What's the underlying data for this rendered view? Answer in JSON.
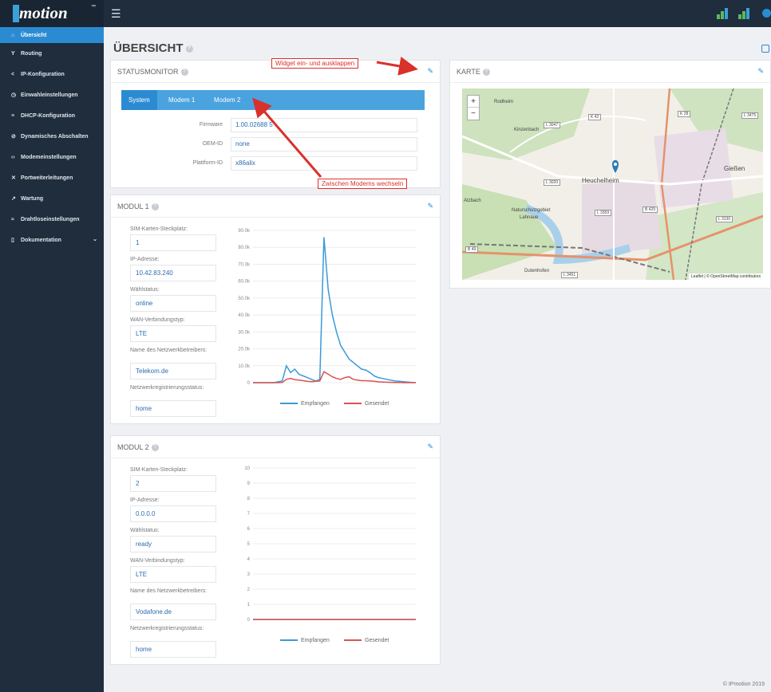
{
  "app": {
    "logo": "motion",
    "logo_tm": "™",
    "menu_icon": "hamburger-icon"
  },
  "sidebar": {
    "items": [
      {
        "label": "Übersicht",
        "icon": "home-icon",
        "active": true
      },
      {
        "label": "Routing",
        "icon": "routing-icon"
      },
      {
        "label": "IP-Konfiguration",
        "icon": "share-icon"
      },
      {
        "label": "Einwahleinstellungen",
        "icon": "dial-icon"
      },
      {
        "label": "DHCP-Konfiguration",
        "icon": "dhcp-icon"
      },
      {
        "label": "Dynamisches Abschalten",
        "icon": "power-icon"
      },
      {
        "label": "Modemeinstellungen",
        "icon": "code-icon"
      },
      {
        "label": "Portweiterleitungen",
        "icon": "shuffle-icon"
      },
      {
        "label": "Wartung",
        "icon": "wrench-icon"
      },
      {
        "label": "Drahtloseinstellungen",
        "icon": "wifi-icon"
      },
      {
        "label": "Dokumentation",
        "icon": "book-icon",
        "chevron": "chevron-down-icon"
      }
    ]
  },
  "page": {
    "title": "ÜBERSICHT",
    "help": "?",
    "footer": "© IPmotion 2019"
  },
  "status_monitor": {
    "title": "STATUSMONITOR",
    "tabs": [
      "System",
      "Modem 1",
      "Modem 2"
    ],
    "fields": [
      {
        "label": "Firmware",
        "value": "1.00.02688 5"
      },
      {
        "label": "OEM-ID",
        "value": "none"
      },
      {
        "label": "Plattform-ID",
        "value": "x86alix"
      }
    ]
  },
  "annotations": {
    "widget": "Widget ein- und ausklappen",
    "modems": "Zwischen Modems wechseln"
  },
  "modul1": {
    "title": "MODUL 1",
    "fields": [
      {
        "label": "SIM-Karten-Steckplatz:",
        "value": "1"
      },
      {
        "label": "IP-Adresse:",
        "value": "10.42.83.240"
      },
      {
        "label": "Wählstatus:",
        "value": "online"
      },
      {
        "label": "WAN-Verbindungstyp:",
        "value": "LTE"
      },
      {
        "label": "Name des Netzwerkbetreibers:",
        "value": "Telekom.de"
      },
      {
        "label": "Netzwerkregistrierungsstatus:",
        "value": "home"
      }
    ],
    "y_ticks": [
      "90.0k",
      "80.0k",
      "70.0k",
      "60.0k",
      "50.0k",
      "40.0k",
      "30.0k",
      "20.0k",
      "10.0k",
      "0"
    ],
    "legend": [
      "Empfangen",
      "Gesendet"
    ]
  },
  "modul2": {
    "title": "MODUL 2",
    "fields": [
      {
        "label": "SIM-Karten-Steckplatz:",
        "value": "2"
      },
      {
        "label": "IP-Adresse:",
        "value": "0.0.0.0"
      },
      {
        "label": "Wählstatus:",
        "value": "ready"
      },
      {
        "label": "WAN-Verbindungstyp:",
        "value": "LTE"
      },
      {
        "label": "Name des Netzwerkbetreibers:",
        "value": "Vodafone.de"
      },
      {
        "label": "Netzwerkregistrierungsstatus:",
        "value": "home"
      }
    ],
    "y_ticks": [
      "10",
      "9",
      "8",
      "7",
      "6",
      "5",
      "4",
      "3",
      "2",
      "1",
      "0"
    ],
    "legend": [
      "Empfangen",
      "Gesendet"
    ]
  },
  "karte": {
    "title": "KARTE",
    "zoom_in": "+",
    "zoom_out": "−",
    "labels": [
      "Heuchelheim",
      "Gießen",
      "Naturschutzgebiet",
      "Lahnaue",
      "Dutenhofen",
      "Kinzenbach",
      "Atzbach",
      "Rodheim"
    ],
    "roads": [
      "L 3047",
      "K 42",
      "K 28",
      "L 3475",
      "L 3020",
      "L 3359",
      "B 429",
      "L 3130",
      "B 49",
      "L 3451"
    ],
    "attribution": "Leaflet | © OpenStreetMap contributors"
  },
  "colors": {
    "accent": "#2b8bd2",
    "received": "#3a9ad9",
    "sent": "#d9534f",
    "annotation": "#d9312b"
  },
  "chart_data": [
    {
      "type": "line",
      "title": "MODUL 1",
      "ylim": [
        0,
        90000
      ],
      "x": [
        0,
        1,
        2,
        3,
        4,
        5,
        6,
        7,
        8,
        9,
        10,
        11,
        12,
        13,
        14,
        15,
        16,
        17,
        18,
        19,
        20,
        21,
        22,
        23,
        24,
        25,
        26,
        27,
        28,
        29,
        30,
        31,
        32,
        33,
        34,
        35,
        36,
        37,
        38,
        39
      ],
      "series": [
        {
          "name": "Empfangen",
          "values": [
            0,
            0,
            0,
            0,
            0,
            0,
            500,
            1000,
            10000,
            6000,
            8000,
            5000,
            4000,
            3000,
            2000,
            1000,
            2000,
            86000,
            55000,
            40000,
            30000,
            22000,
            18000,
            14000,
            12000,
            10000,
            8000,
            7500,
            6000,
            4000,
            3000,
            2500,
            2000,
            1500,
            1000,
            800,
            600,
            400,
            200,
            100
          ]
        },
        {
          "name": "Gesendet",
          "values": [
            0,
            0,
            0,
            0,
            0,
            0,
            0,
            100,
            2000,
            2500,
            1800,
            1500,
            1200,
            800,
            600,
            800,
            1000,
            6500,
            5000,
            3500,
            2500,
            2000,
            3000,
            3500,
            2000,
            1500,
            1200,
            1200,
            1000,
            800,
            500,
            400,
            300,
            200,
            100,
            100,
            0,
            0,
            0,
            0
          ]
        }
      ]
    },
    {
      "type": "line",
      "title": "MODUL 2",
      "ylim": [
        0,
        10
      ],
      "x": [
        0,
        39
      ],
      "series": [
        {
          "name": "Empfangen",
          "values": [
            0,
            0
          ]
        },
        {
          "name": "Gesendet",
          "values": [
            0,
            0
          ]
        }
      ]
    }
  ]
}
